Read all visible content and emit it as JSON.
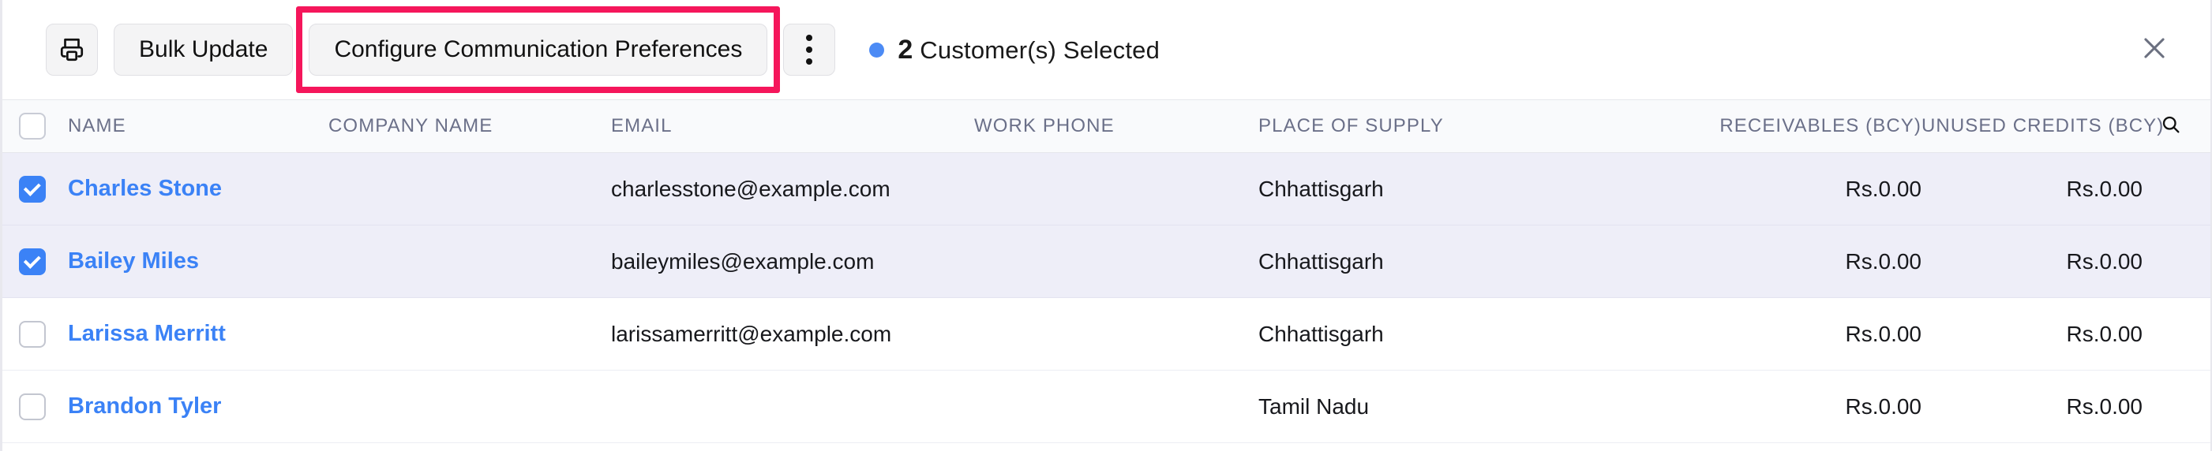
{
  "toolbar": {
    "print_button": {
      "icon": "printer-icon",
      "label": ""
    },
    "bulk_update_label": "Bulk Update",
    "configure_label": "Configure Communication Preferences",
    "more_button_icon": "kebab-menu-icon",
    "selection": {
      "count": "2",
      "text": "Customer(s) Selected",
      "dot_color": "#4c8bf5"
    },
    "close_icon": "close-icon",
    "highlight_color": "#f5165b"
  },
  "table": {
    "search_icon": "search-icon",
    "columns": [
      {
        "key": "name",
        "label": "NAME"
      },
      {
        "key": "comp",
        "label": "COMPANY NAME"
      },
      {
        "key": "email",
        "label": "EMAIL"
      },
      {
        "key": "phone",
        "label": "WORK PHONE"
      },
      {
        "key": "place",
        "label": "PLACE OF SUPPLY"
      },
      {
        "key": "recv",
        "label": "RECEIVABLES (BCY)"
      },
      {
        "key": "cred",
        "label": "UNUSED CREDITS (BCY)"
      }
    ],
    "rows": [
      {
        "selected": true,
        "name": "Charles Stone",
        "company": "",
        "email": "charlesstone@example.com",
        "work_phone": "",
        "place_of_supply": "Chhattisgarh",
        "receivables": "Rs.0.00",
        "unused_credits": "Rs.0.00"
      },
      {
        "selected": true,
        "name": "Bailey Miles",
        "company": "",
        "email": "baileymiles@example.com",
        "work_phone": "",
        "place_of_supply": "Chhattisgarh",
        "receivables": "Rs.0.00",
        "unused_credits": "Rs.0.00"
      },
      {
        "selected": false,
        "name": "Larissa Merritt",
        "company": "",
        "email": "larissamerritt@example.com",
        "work_phone": "",
        "place_of_supply": "Chhattisgarh",
        "receivables": "Rs.0.00",
        "unused_credits": "Rs.0.00"
      },
      {
        "selected": false,
        "name": "Brandon Tyler",
        "company": "",
        "email": "",
        "work_phone": "",
        "place_of_supply": "Tamil Nadu",
        "receivables": "Rs.0.00",
        "unused_credits": "Rs.0.00"
      }
    ]
  },
  "colors": {
    "link": "#3b82f6",
    "checkbox_checked": "#3b82f6",
    "selected_row_bg": "#eeeef8",
    "header_bg": "#f9fafc",
    "annotation": "#f5165b"
  }
}
